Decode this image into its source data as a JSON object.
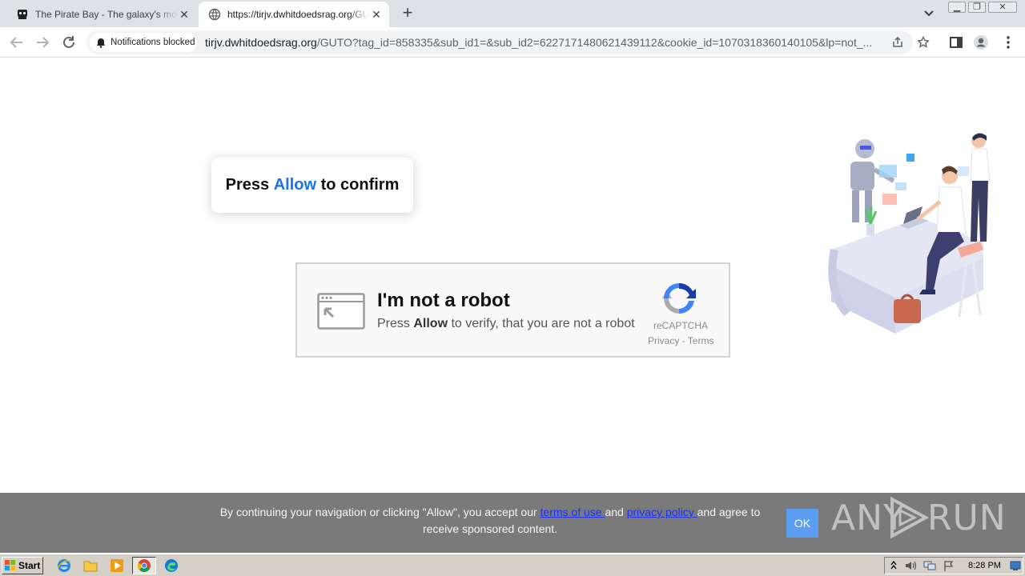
{
  "browser": {
    "tabs": [
      {
        "title": "The Pirate Bay - The galaxy's most resilient",
        "favicon": "pirate-ship-icon",
        "active": false
      },
      {
        "title": "https://tirjv.dwhitdoedsrag.org/GUTO",
        "favicon": "globe-icon",
        "active": true
      }
    ],
    "notifications_chip": "Notifications blocked",
    "url_host": "tirjv.dwhitdoedsrag.org",
    "url_rest": "/GUTO?tag_id=858335&sub_id1=&sub_id2=6227171480621439112&cookie_id=1070318360140105&lp=not_..."
  },
  "page": {
    "confirm": {
      "prefix": "Press ",
      "highlight": "Allow",
      "suffix": " to confirm"
    },
    "captcha": {
      "heading": "I'm not a robot",
      "sub_prefix": "Press ",
      "sub_bold": "Allow",
      "sub_suffix": " to verify, that you are not a robot",
      "brand": "reCAPTCHA",
      "links": "Privacy - Terms"
    },
    "consent": {
      "text_1": "By continuing your navigation or clicking \"Allow\", you accept our ",
      "terms_link": "terms of use ",
      "text_2": "and ",
      "privacy_link": "privacy policy ",
      "text_3": "and agree to receive sponsored content.",
      "ok_label": "OK"
    },
    "watermark": {
      "left": "ANY",
      "right": "RUN"
    }
  },
  "taskbar": {
    "start_label": "Start",
    "apps": [
      "ie-icon",
      "folder-icon",
      "media-player-icon",
      "chrome-icon",
      "edge-icon"
    ],
    "clock": "8:28 PM"
  },
  "colors": {
    "accent": "#1a73e8",
    "consent_bg": "#7a7a7a",
    "ok_bg": "#5b9df0",
    "link": "#1a2fff"
  }
}
